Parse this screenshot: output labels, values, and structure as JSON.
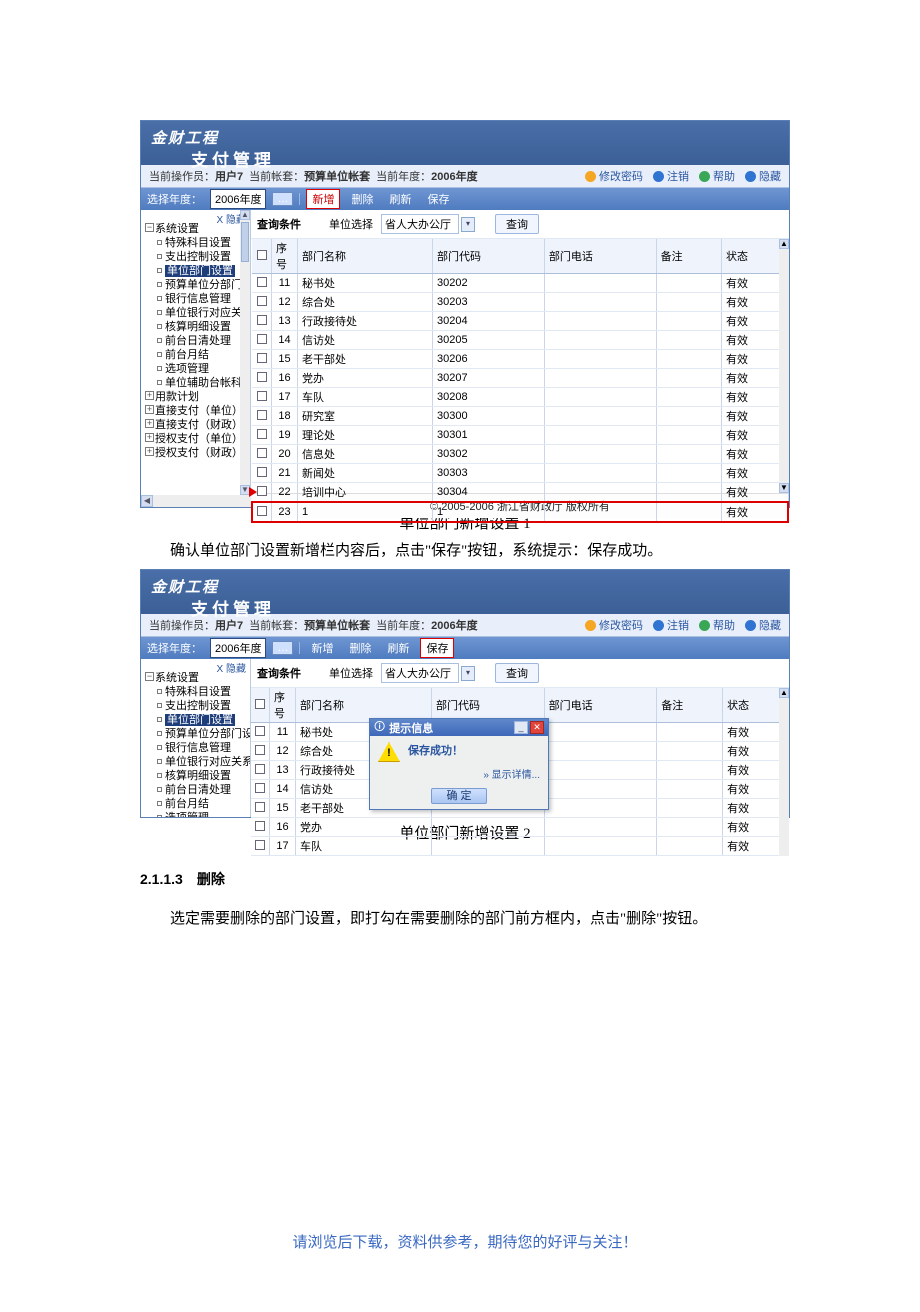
{
  "header": {
    "brand1": "金财工程",
    "brand2": "支付管理",
    "operator_label": "当前操作员：",
    "operator": "用户7",
    "account_label": "当前帐套：",
    "account": "预算单位帐套",
    "year_label": "当前年度：",
    "year": "2006年度",
    "links": {
      "pwd": "修改密码",
      "logout": "注销",
      "help": "帮助",
      "hide": "隐藏"
    }
  },
  "toolbar": {
    "year_label": "选择年度：",
    "year": "2006年度",
    "btn_add": "新增",
    "btn_del": "删除",
    "btn_refresh": "刷新",
    "btn_save": "保存"
  },
  "tree": {
    "close": "X 隐藏",
    "root": "系统设置",
    "items": [
      "特殊科目设置",
      "支出控制设置",
      "单位部门设置",
      "预算单位分部门设置",
      "银行信息管理",
      "单位银行对应关系设置",
      "核算明细设置",
      "前台日清处理",
      "前台月结",
      "选项管理",
      "单位辅助台帐科目设置"
    ],
    "roots2": [
      "用款计划",
      "直接支付（单位）",
      "直接支付（财政）",
      "授权支付（单位）",
      "授权支付（财政）"
    ]
  },
  "query": {
    "label": "查询条件",
    "unit_label": "单位选择",
    "unit_value": "省人大办公厅",
    "btn": "查询"
  },
  "grid": {
    "cols": [
      "序号",
      "部门名称",
      "部门代码",
      "部门电话",
      "备注",
      "状态"
    ],
    "rows": [
      {
        "n": "11",
        "name": "秘书处",
        "code": "30202",
        "tel": "",
        "memo": "",
        "st": "有效"
      },
      {
        "n": "12",
        "name": "综合处",
        "code": "30203",
        "tel": "",
        "memo": "",
        "st": "有效"
      },
      {
        "n": "13",
        "name": "行政接待处",
        "code": "30204",
        "tel": "",
        "memo": "",
        "st": "有效"
      },
      {
        "n": "14",
        "name": "信访处",
        "code": "30205",
        "tel": "",
        "memo": "",
        "st": "有效"
      },
      {
        "n": "15",
        "name": "老干部处",
        "code": "30206",
        "tel": "",
        "memo": "",
        "st": "有效"
      },
      {
        "n": "16",
        "name": "党办",
        "code": "30207",
        "tel": "",
        "memo": "",
        "st": "有效"
      },
      {
        "n": "17",
        "name": "车队",
        "code": "30208",
        "tel": "",
        "memo": "",
        "st": "有效"
      },
      {
        "n": "18",
        "name": "研究室",
        "code": "30300",
        "tel": "",
        "memo": "",
        "st": "有效"
      },
      {
        "n": "19",
        "name": "理论处",
        "code": "30301",
        "tel": "",
        "memo": "",
        "st": "有效"
      },
      {
        "n": "20",
        "name": "信息处",
        "code": "30302",
        "tel": "",
        "memo": "",
        "st": "有效"
      },
      {
        "n": "21",
        "name": "新闻处",
        "code": "30303",
        "tel": "",
        "memo": "",
        "st": "有效"
      },
      {
        "n": "22",
        "name": "培训中心",
        "code": "30304",
        "tel": "",
        "memo": "",
        "st": "有效"
      }
    ],
    "new_row": {
      "n": "23",
      "name": "1",
      "code": "1",
      "tel": "",
      "memo": "",
      "st": "有效"
    }
  },
  "grid2_rows": [
    {
      "n": "11",
      "name": "秘书处",
      "code": "30202",
      "st": "有效"
    },
    {
      "n": "12",
      "name": "综合处",
      "code": "",
      "st": "有效"
    },
    {
      "n": "13",
      "name": "行政接待处",
      "code": "",
      "st": "有效"
    },
    {
      "n": "14",
      "name": "信访处",
      "code": "",
      "st": "有效"
    },
    {
      "n": "15",
      "name": "老干部处",
      "code": "",
      "st": "有效"
    },
    {
      "n": "16",
      "name": "党办",
      "code": "",
      "st": "有效"
    },
    {
      "n": "17",
      "name": "车队",
      "code": "",
      "st": "有效"
    }
  ],
  "dialog": {
    "title": "提示信息",
    "msg": "保存成功！",
    "detail": "» 显示详情...",
    "ok": "确 定"
  },
  "copy": "© 2005-2006  浙江省财政厅 版权所有",
  "doc": {
    "cap1": "单位部门新增设置 1",
    "para1": "确认单位部门设置新增栏内容后，点击\"保存\"按钮，系统提示：保存成功。",
    "cap2": "单位部门新增设置 2",
    "h": "2.1.1.3　删除",
    "para2": "选定需要删除的部门设置，即打勾在需要删除的部门前方框内，点击\"删除\"按钮。",
    "footer": "请浏览后下载，资料供参考，期待您的好评与关注！"
  }
}
